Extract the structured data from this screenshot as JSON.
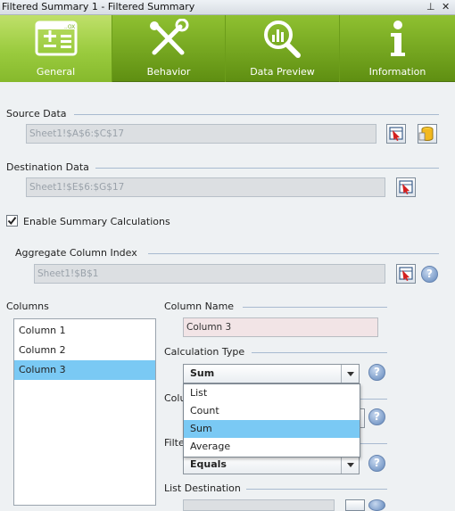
{
  "window": {
    "title": "Filtered Summary 1 - Filtered Summary",
    "pin_glyph": "⊥",
    "close_glyph": "✕"
  },
  "ribbon": {
    "tabs": [
      {
        "label": "General",
        "icon": "form-icon",
        "active": true
      },
      {
        "label": "Behavior",
        "icon": "tools-icon",
        "active": false
      },
      {
        "label": "Data Preview",
        "icon": "magnifier-chart-icon",
        "active": false
      },
      {
        "label": "Information",
        "icon": "info-icon",
        "active": false
      }
    ]
  },
  "source_data": {
    "label": "Source Data",
    "value": "Sheet1!$A$6:$C$17"
  },
  "destination_data": {
    "label": "Destination Data",
    "value": "Sheet1!$E$6:$G$17"
  },
  "enable_summary": {
    "label": "Enable Summary Calculations",
    "checked": true
  },
  "aggregate": {
    "label": "Aggregate Column Index",
    "value": "Sheet1!$B$1"
  },
  "columns": {
    "label": "Columns",
    "items": [
      "Column 1",
      "Column 2",
      "Column 3"
    ],
    "selected": "Column 3"
  },
  "column_name": {
    "label": "Column Name",
    "value": "Column 3"
  },
  "calculation_type": {
    "label": "Calculation Type",
    "value": "Sum",
    "options": [
      "List",
      "Count",
      "Sum",
      "Average"
    ],
    "partial_label_behind_dropdown": "Colu"
  },
  "filter": {
    "partial_label": "Filte",
    "value": "Equals"
  },
  "list_destination": {
    "label": "List Destination"
  },
  "help_glyph": "?",
  "colors": {
    "ribbon_green": "#7aae22",
    "selection_blue": "#7ac9f4"
  }
}
